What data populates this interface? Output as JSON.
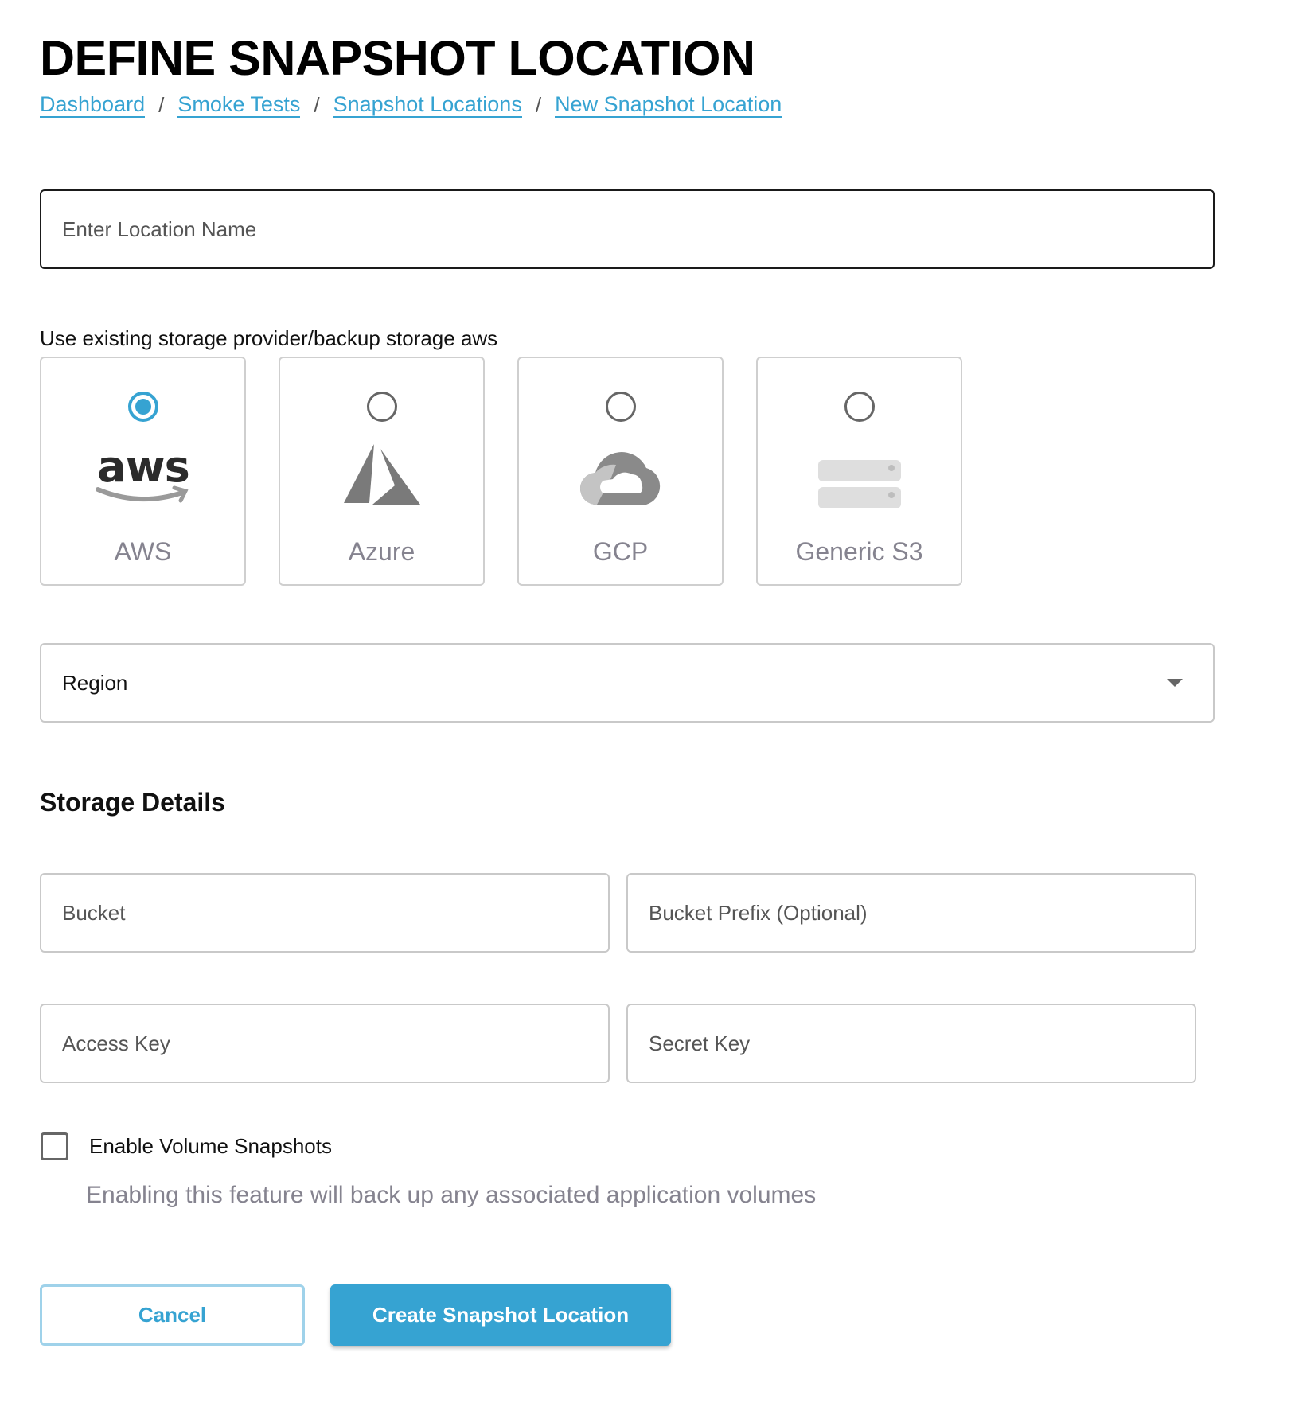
{
  "header": {
    "title": "DEFINE SNAPSHOT LOCATION",
    "breadcrumb": [
      {
        "label": "Dashboard"
      },
      {
        "label": "Smoke Tests"
      },
      {
        "label": "Snapshot Locations"
      },
      {
        "label": "New Snapshot Location"
      }
    ],
    "separator": "/"
  },
  "form": {
    "location_name": {
      "value": "",
      "placeholder": "Enter Location Name"
    },
    "provider_label": "Use existing storage provider/backup storage aws",
    "providers": [
      {
        "name": "AWS",
        "icon": "aws-logo-icon",
        "selected": true
      },
      {
        "name": "Azure",
        "icon": "azure-logo-icon",
        "selected": false
      },
      {
        "name": "GCP",
        "icon": "gcp-cloud-icon",
        "selected": false
      },
      {
        "name": "Generic S3",
        "icon": "server-storage-icon",
        "selected": false
      }
    ],
    "region": {
      "value": "Region",
      "icon": "caret-down-icon"
    },
    "storage_section_title": "Storage Details",
    "bucket": {
      "value": "",
      "placeholder": "Bucket"
    },
    "bucket_prefix": {
      "value": "",
      "placeholder": "Bucket Prefix (Optional)"
    },
    "access_key": {
      "value": "",
      "placeholder": "Access Key"
    },
    "secret_key": {
      "value": "",
      "placeholder": "Secret Key"
    },
    "volume_snapshots": {
      "label": "Enable Volume Snapshots",
      "checked": false,
      "helper": "Enabling this feature will back up any associated application volumes"
    }
  },
  "actions": {
    "cancel_label": "Cancel",
    "create_label": "Create Snapshot Location"
  },
  "colors": {
    "accent": "#36a3d2",
    "muted_text": "#85838f",
    "border": "#c9c9c9"
  }
}
